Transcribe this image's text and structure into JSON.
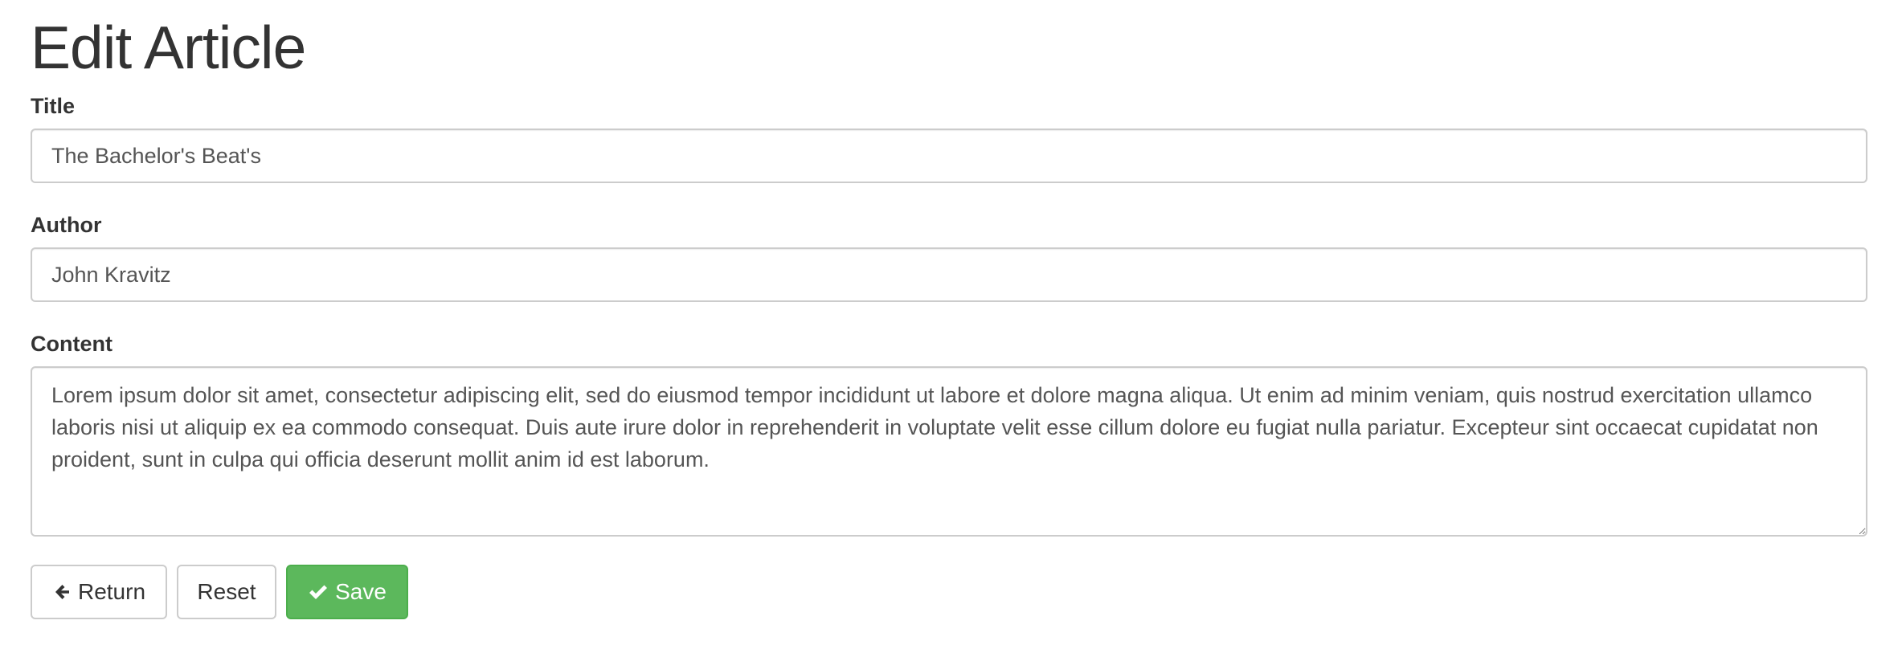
{
  "header": {
    "title": "Edit Article"
  },
  "form": {
    "title": {
      "label": "Title",
      "value": "The Bachelor's Beat's"
    },
    "author": {
      "label": "Author",
      "value": "John Kravitz"
    },
    "content": {
      "label": "Content",
      "value": "Lorem ipsum dolor sit amet, consectetur adipiscing elit, sed do eiusmod tempor incididunt ut labore et dolore magna aliqua. Ut enim ad minim veniam, quis nostrud exercitation ullamco laboris nisi ut aliquip ex ea commodo consequat. Duis aute irure dolor in reprehenderit in voluptate velit esse cillum dolore eu fugiat nulla pariatur. Excepteur sint occaecat cupidatat non proident, sunt in culpa qui officia deserunt mollit anim id est laborum."
    }
  },
  "actions": {
    "return_label": "Return",
    "return_icon": "arrow-left-icon",
    "reset_label": "Reset",
    "save_label": "Save",
    "save_icon": "check-icon"
  },
  "colors": {
    "save_button": "#5cb85c",
    "text": "#333333",
    "border": "#cccccc"
  }
}
